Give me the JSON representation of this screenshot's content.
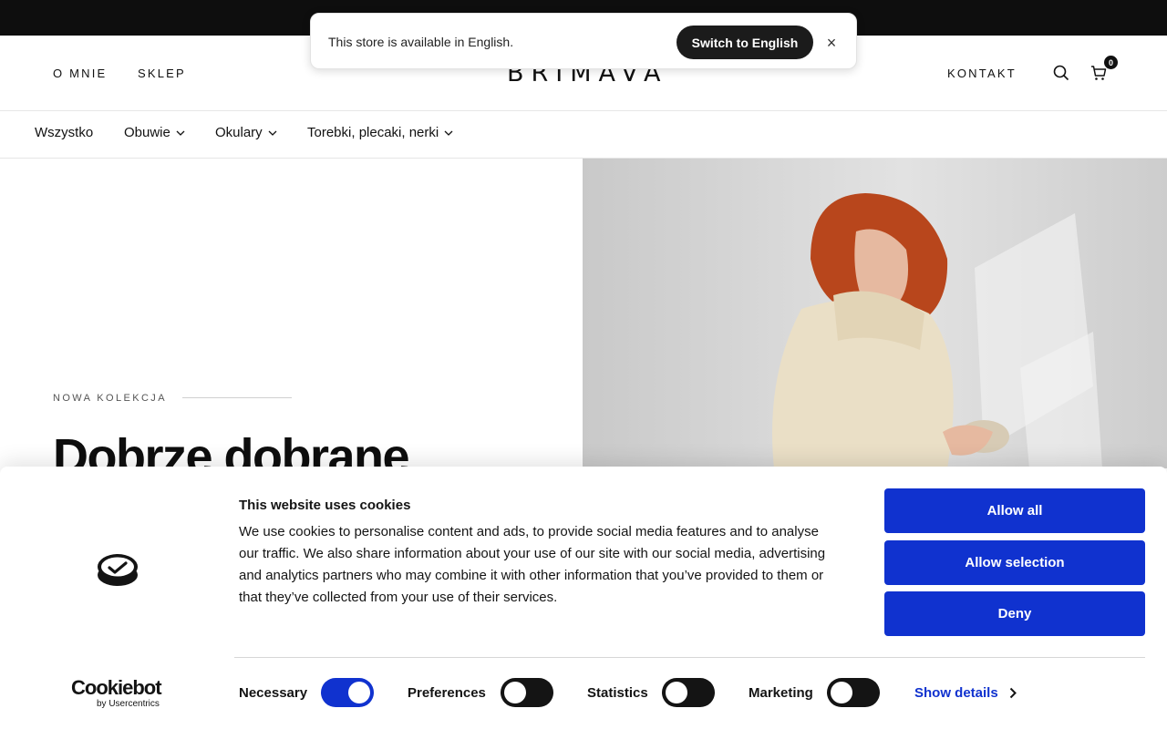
{
  "header": {
    "nav_left": [
      "O MNIE",
      "SKLEP"
    ],
    "logo": "BRIMAVA",
    "nav_right": "KONTAKT",
    "cart_count": "0"
  },
  "category_nav": {
    "items": [
      {
        "label": "Wszystko",
        "has_dropdown": false
      },
      {
        "label": "Obuwie",
        "has_dropdown": true
      },
      {
        "label": "Okulary",
        "has_dropdown": true
      },
      {
        "label": "Torebki, plecaki, nerki",
        "has_dropdown": true
      }
    ]
  },
  "hero": {
    "eyebrow": "NOWA KOLEKCJA",
    "heading": "Dobrze dobrane"
  },
  "language_popup": {
    "message": "This store is available in English.",
    "button_label": "Switch to English",
    "close_label": "×"
  },
  "cookie_banner": {
    "title": "This website uses cookies",
    "body": "We use cookies to personalise content and ads, to provide social media features and to analyse our traffic. We also share information about your use of our site with our social media, advertising and analytics partners who may combine it with other information that you’ve provided to them or that they’ve collected from your use of their services.",
    "buttons": {
      "allow_all": "Allow all",
      "allow_selection": "Allow selection",
      "deny": "Deny"
    },
    "brand": {
      "name": "Cookiebot",
      "sub": "by Usercentrics"
    },
    "toggles": [
      {
        "label": "Necessary",
        "on": true
      },
      {
        "label": "Preferences",
        "on": false
      },
      {
        "label": "Statistics",
        "on": false
      },
      {
        "label": "Marketing",
        "on": false
      }
    ],
    "show_details": "Show details",
    "accent_color": "#1032cf"
  }
}
